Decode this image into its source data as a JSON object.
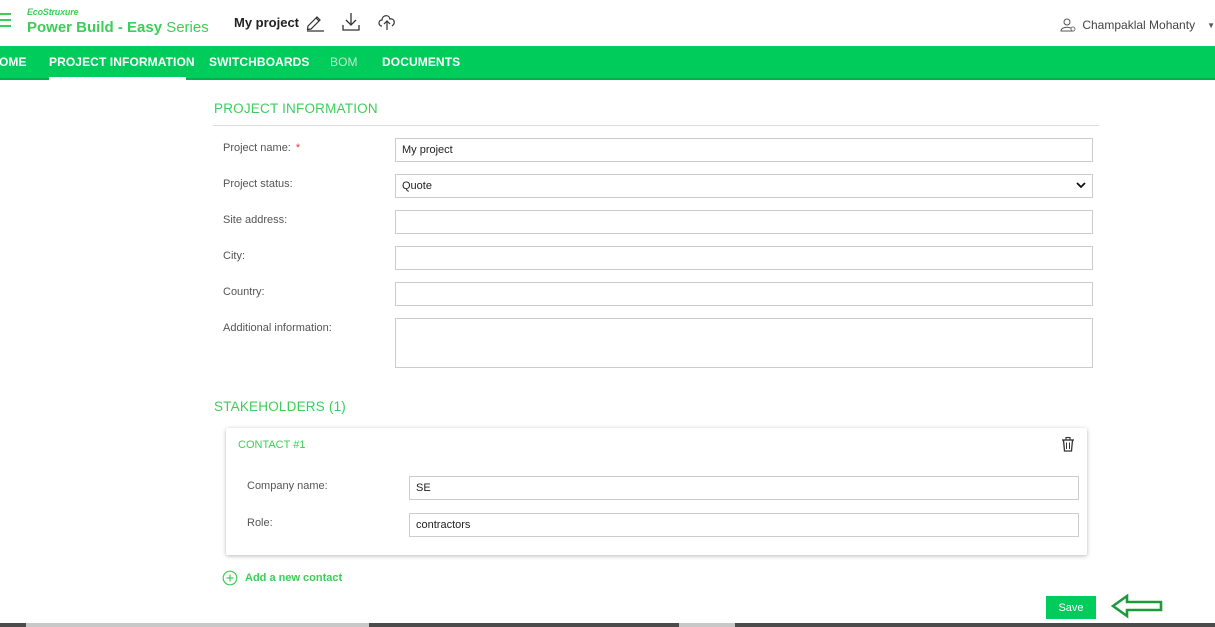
{
  "header": {
    "brand_small": "EcoStruxure",
    "brand_main_bold": "Power Build - Easy",
    "brand_main_light": " Series",
    "project_title": "My project",
    "user_name": "Champaklal Mohanty"
  },
  "nav": {
    "items": [
      {
        "label": "OME"
      },
      {
        "label": "PROJECT INFORMATION"
      },
      {
        "label": "SWITCHBOARDS"
      },
      {
        "label": "BOM"
      },
      {
        "label": "DOCUMENTS"
      }
    ],
    "active": "PROJECT INFORMATION"
  },
  "project_info": {
    "title": "PROJECT INFORMATION",
    "fields": {
      "name_label": "Project name:",
      "name_required": "*",
      "name_value": "My project",
      "status_label": "Project status:",
      "status_value": "Quote",
      "site_label": "Site address:",
      "site_value": "",
      "city_label": "City:",
      "city_value": "",
      "country_label": "Country:",
      "country_value": "",
      "additional_label": "Additional information:",
      "additional_value": ""
    }
  },
  "stakeholders": {
    "title": "STAKEHOLDERS (1)",
    "contact": {
      "title": "CONTACT #1",
      "company_label": "Company name:",
      "company_value": "SE",
      "role_label": "Role:",
      "role_value": "contractors"
    },
    "add_contact_label": "Add a new contact"
  },
  "actions": {
    "save_label": "Save"
  },
  "colors": {
    "brand_green": "#3dcd58",
    "nav_green": "#00cc5c",
    "arrow_green": "#1f9a3a"
  }
}
